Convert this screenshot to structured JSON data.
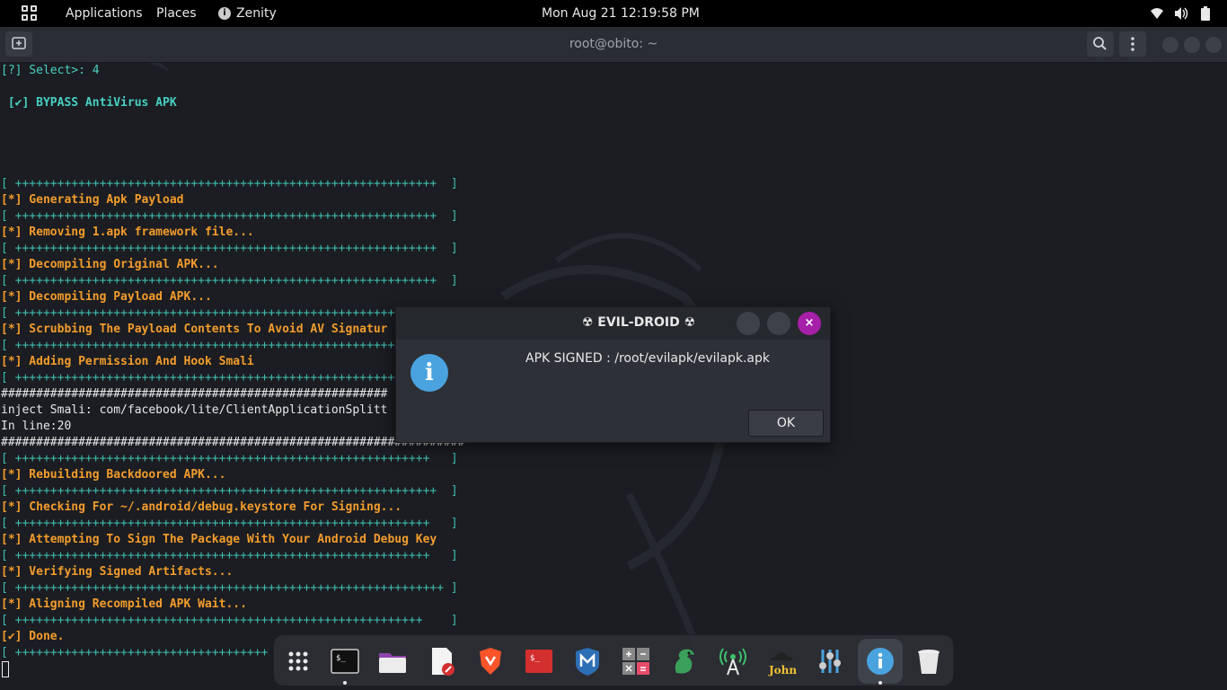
{
  "topbar": {
    "applications_label": "Applications",
    "places_label": "Places",
    "zenity_label": "Zenity",
    "clock": "Mon Aug 21  12:19:58 PM"
  },
  "terminal": {
    "title": "root@obito: ~",
    "lines": [
      {
        "text": "[?] Select>: 4",
        "style": "prompt"
      },
      {
        "text": " [✔] BYPASS AntiVirus APK",
        "style": "bypass"
      },
      {
        "text": "[ ++++++++++++++++++++++++++++++++++++++++++++++++++++++++++++  ]",
        "style": "sep"
      },
      {
        "text": "[*] Generating Apk Payload",
        "style": "step"
      },
      {
        "text": "[ ++++++++++++++++++++++++++++++++++++++++++++++++++++++++++++  ]",
        "style": "sep"
      },
      {
        "text": "[*] Removing 1.apk framework file...",
        "style": "step"
      },
      {
        "text": "[ ++++++++++++++++++++++++++++++++++++++++++++++++++++++++++++  ]",
        "style": "sep"
      },
      {
        "text": "[*] Decompiling Original APK...",
        "style": "step"
      },
      {
        "text": "[ ++++++++++++++++++++++++++++++++++++++++++++++++++++++++++++  ]",
        "style": "sep"
      },
      {
        "text": "[*] Decompiling Payload APK...",
        "style": "step"
      },
      {
        "text": "[ ++++++++++++++++++++++++++++++++++++++++++++++++++++++++",
        "style": "sep"
      },
      {
        "text": "[*] Scrubbing The Payload Contents To Avoid AV Signatur",
        "style": "step"
      },
      {
        "text": "[ ++++++++++++++++++++++++++++++++++++++++++++++++++++++++",
        "style": "sep"
      },
      {
        "text": "[*] Adding Permission And Hook Smali",
        "style": "step"
      },
      {
        "text": "[ ++++++++++++++++++++++++++++++++++++++++++++++++++++++++",
        "style": "sep"
      },
      {
        "text": "#######################################################",
        "style": "plain"
      },
      {
        "text": "inject Smali: com/facebook/lite/ClientApplicationSplitt",
        "style": "plain"
      },
      {
        "text": "In line:20",
        "style": "plain"
      },
      {
        "text": "##################################################################",
        "style": "plain"
      },
      {
        "text": "[ +++++++++++++++++++++++++++++++++++++++++++++++++++++++++++   ]",
        "style": "sep"
      },
      {
        "text": "[*] Rebuilding Backdoored APK...",
        "style": "step"
      },
      {
        "text": "[ ++++++++++++++++++++++++++++++++++++++++++++++++++++++++++++  ]",
        "style": "sep"
      },
      {
        "text": "[*] Checking For ~/.android/debug.keystore For Signing...",
        "style": "step"
      },
      {
        "text": "[ +++++++++++++++++++++++++++++++++++++++++++++++++++++++++++   ]",
        "style": "sep"
      },
      {
        "text": "[*] Attempting To Sign The Package With Your Android Debug Key",
        "style": "step"
      },
      {
        "text": "[ +++++++++++++++++++++++++++++++++++++++++++++++++++++++++++   ]",
        "style": "sep"
      },
      {
        "text": "[*] Verifying Signed Artifacts...",
        "style": "step"
      },
      {
        "text": "[ +++++++++++++++++++++++++++++++++++++++++++++++++++++++++++++ ]",
        "style": "sep"
      },
      {
        "text": "[*] Aligning Recompiled APK Wait...",
        "style": "step"
      },
      {
        "text": "[ ++++++++++++++++++++++++++++++++++++++++++++++++++++++++++    ]",
        "style": "sep"
      },
      {
        "text": "[✔] Done.",
        "style": "step"
      },
      {
        "text": "[ ++++++++++++++++++++++++++++++++++++",
        "style": "sep"
      }
    ]
  },
  "dialog": {
    "title": "☢ EVIL-DROID ☢",
    "message": "APK SIGNED : /root/evilapk/evilapk.apk",
    "ok_label": "OK",
    "close_glyph": "×",
    "info_glyph": "i"
  },
  "dock": {
    "items": [
      "show-apps",
      "terminal",
      "files",
      "text-editor",
      "brave-browser",
      "terminal-red",
      "metasploit",
      "calculator",
      "kali-dragon",
      "wireless-tool",
      "john-the-ripper",
      "settings-tool",
      "zenity-info",
      "trash"
    ]
  }
}
